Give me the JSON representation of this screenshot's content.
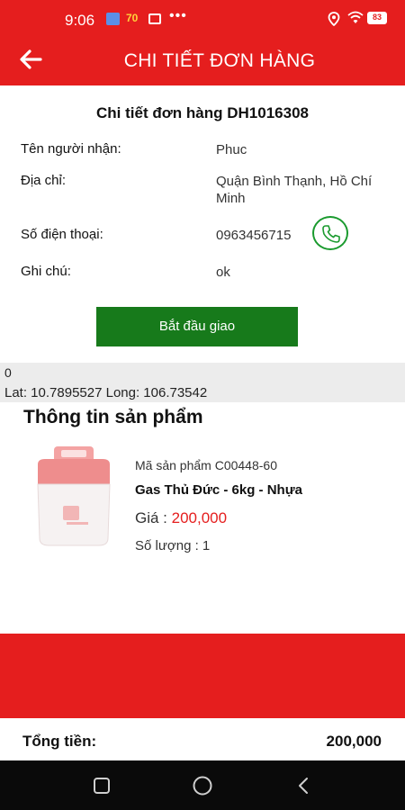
{
  "status_bar": {
    "time": "9:06",
    "badge": "70",
    "dots": "•••",
    "battery": "83"
  },
  "app_bar": {
    "title": "CHI TIẾT ĐƠN HÀNG"
  },
  "order": {
    "title": "Chi tiết đơn hàng DH1016308",
    "recipient_label": "Tên người nhận:",
    "recipient": "Phuc",
    "address_label": "Địa chỉ:",
    "address": "Quận Bình Thạnh, Hồ Chí Minh",
    "phone_label": "Số điện thoại:",
    "phone": "0963456715",
    "note_label": "Ghi chú:",
    "note": "ok",
    "start_button": "Bắt đầu giao"
  },
  "location": {
    "line1": "0",
    "line2": "Lat: 10.7895527 Long: 106.73542"
  },
  "products": {
    "section_title": "Thông tin sản phẩm",
    "items": [
      {
        "code": "Mã sản phẩm C00448-60",
        "name": "Gas Thủ Đức - 6kg - Nhựa",
        "price_label": "Giá : ",
        "price": "200,000",
        "quantity": "Số lượng : 1"
      }
    ]
  },
  "footer": {
    "total_label": "Tổng tiền:",
    "total_value": "200,000"
  },
  "colors": {
    "primary_red": "#e51e1e",
    "button_green": "#177a1b",
    "phone_green": "#1a9a2e"
  },
  "icons": [
    "back-arrow-icon",
    "phone-icon",
    "location-icon",
    "wifi-icon",
    "battery-icon",
    "nav-recent-icon",
    "nav-home-icon",
    "nav-back-icon"
  ]
}
